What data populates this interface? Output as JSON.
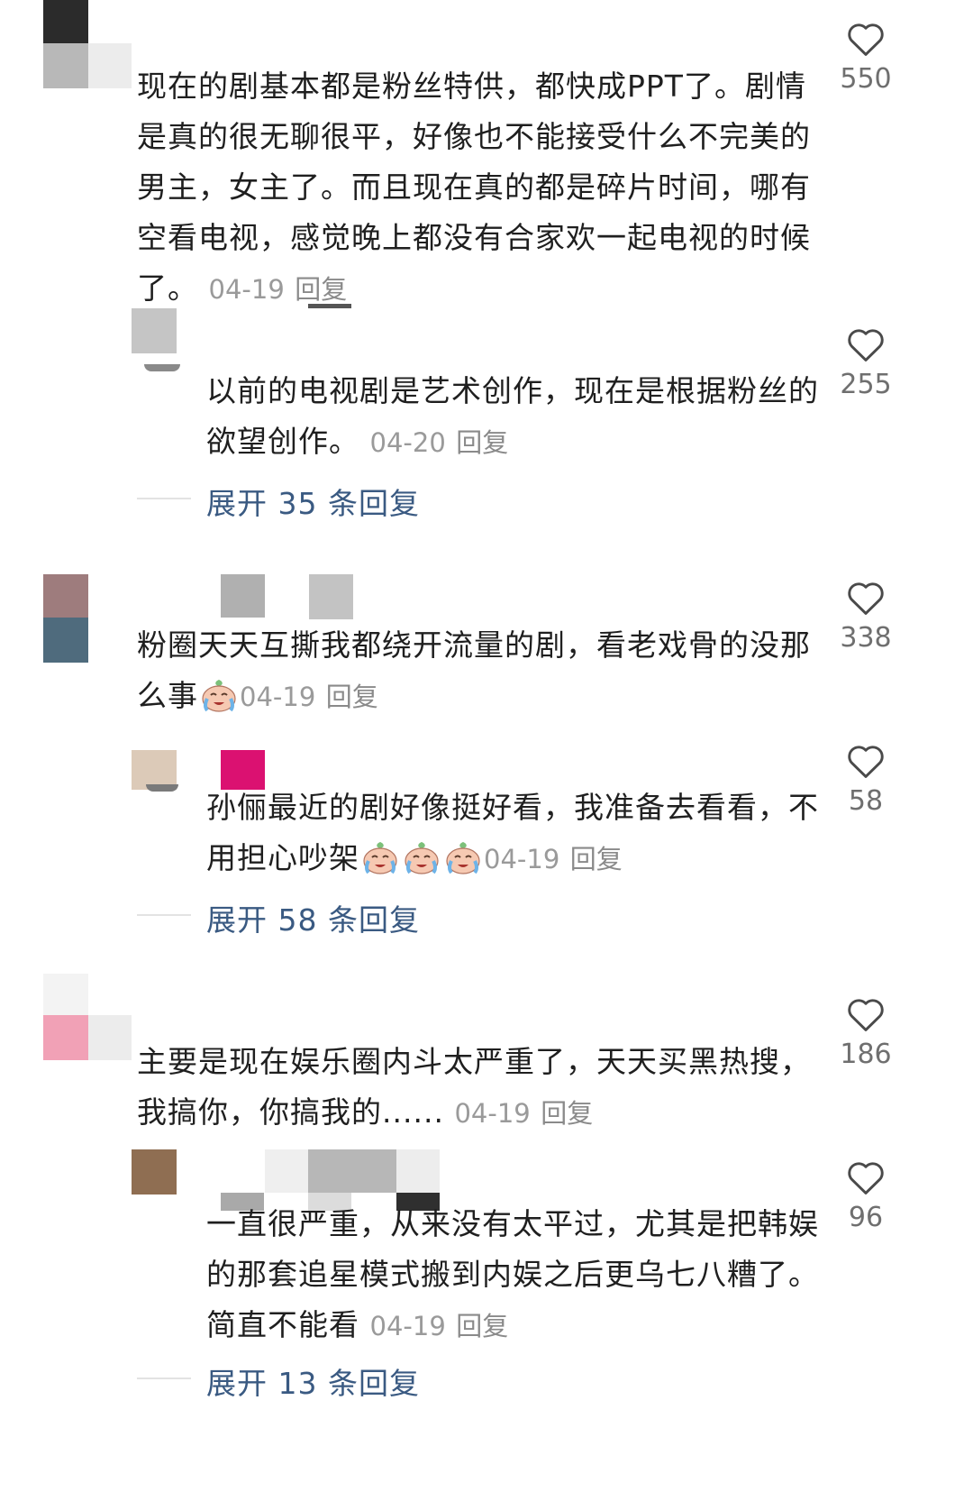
{
  "colors": {
    "text": "#1f1f1f",
    "meta": "#9a9a9a",
    "expand": "#3a5a82",
    "like": "#6f6f6f"
  },
  "comments": [
    {
      "text_lines": [
        "现在的剧基本都是粉丝特供，都快成PPT了。剧情",
        "是真的很无聊很平，好像也不能接受什么不完美的",
        "男主，女主了。而且现在真的都是碎片时间，哪有",
        "空看电视，感觉晚上都没有合家欢一起电视的时候",
        "了。"
      ],
      "date": "04-19",
      "reply": "回复",
      "likes": "550",
      "sub": {
        "text_lines": [
          "以前的电视剧是艺术创作，现在是根据粉丝的",
          "欲望创作。"
        ],
        "date": "04-20",
        "reply": "回复",
        "likes": "255"
      },
      "expand": "展开 35 条回复"
    },
    {
      "text_lines": [
        "粉圈天天互撕我都绕开流量的剧，看老戏骨的没那",
        "么事"
      ],
      "date": "04-19",
      "reply": "回复",
      "likes": "338",
      "emoji": "crying-face-emoji",
      "sub": {
        "text_lines": [
          "孙俪最近的剧好像挺好看，我准备去看看，不",
          "用担心吵架"
        ],
        "date": "04-19",
        "reply": "回复",
        "likes": "58",
        "emoji": "crying-face-emoji x3"
      },
      "expand": "展开 58 条回复"
    },
    {
      "text_lines": [
        "主要是现在娱乐圈内斗太严重了，天天买黑热搜，",
        "我搞你，你搞我的......"
      ],
      "date": "04-19",
      "reply": "回复",
      "likes": "186",
      "sub": {
        "text_lines": [
          "一直很严重，从来没有太平过，尤其是把韩娱",
          "的那套追星模式搬到内娱之后更乌七八糟了。",
          "简直不能看"
        ],
        "date": "04-19",
        "reply": "回复",
        "likes": "96"
      },
      "expand": "展开 13 条回复"
    }
  ]
}
